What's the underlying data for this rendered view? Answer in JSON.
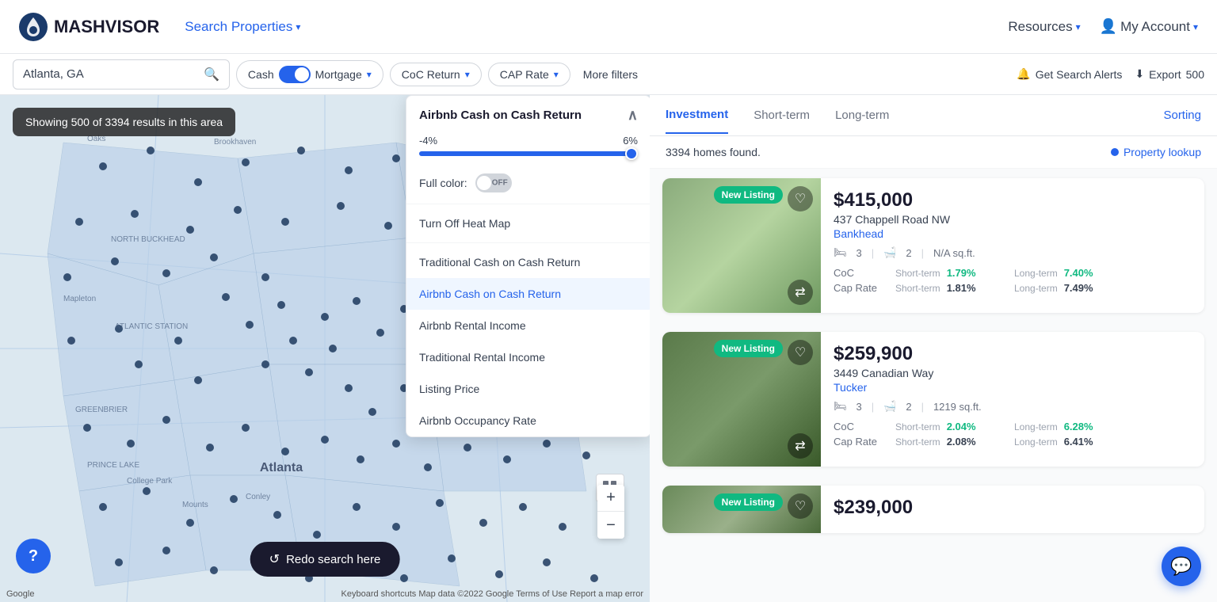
{
  "header": {
    "logo_text": "MASHVISOR",
    "nav_search": "Search Properties",
    "nav_resources": "Resources",
    "nav_account": "My Account"
  },
  "search_bar": {
    "location_value": "Atlanta, GA",
    "location_placeholder": "Atlanta, GA",
    "toggle_label_left": "Cash",
    "toggle_label_right": "Mortgage",
    "filter_coc": "CoC Return",
    "filter_cap": "CAP Rate",
    "more_filters": "More filters",
    "alert_label": "Get Search Alerts",
    "export_label": "Export",
    "export_count": "500"
  },
  "map": {
    "overlay_text": "Showing 500 of 3394 results in this area",
    "redo_label": "Redo search here",
    "attribution": "Google",
    "attribution_right": "Keyboard shortcuts  Map data ©2022 Google  Terms of Use  Report a map error"
  },
  "dropdown": {
    "title": "Airbnb Cash on Cash Return",
    "range_min": "-4%",
    "range_max": "6%",
    "full_color_label": "Full color:",
    "toggle_state": "OFF",
    "items": [
      {
        "label": "Turn Off Heat Map",
        "active": false
      },
      {
        "label": "Traditional Cash on Cash Return",
        "active": false
      },
      {
        "label": "Airbnb Cash on Cash Return",
        "active": true
      },
      {
        "label": "Airbnb Rental Income",
        "active": false
      },
      {
        "label": "Traditional Rental Income",
        "active": false
      },
      {
        "label": "Listing Price",
        "active": false
      },
      {
        "label": "Airbnb Occupancy Rate",
        "active": false
      }
    ]
  },
  "tabs": {
    "items": [
      "Investment",
      "Short-term",
      "Long-term"
    ],
    "active": "Investment",
    "sorting_label": "Sorting"
  },
  "results": {
    "homes_found": "3394 homes found.",
    "property_lookup_label": "Property lookup"
  },
  "properties": [
    {
      "price": "$415,000",
      "address": "437 Chappell Road NW",
      "neighborhood": "Bankhead",
      "beds": "3",
      "baths": "2",
      "sqft": "N/A sq.ft.",
      "new_listing": true,
      "coc_short_term": "1.79%",
      "coc_long_term": "7.40%",
      "cap_short_term": "1.81%",
      "cap_long_term": "7.49%",
      "image_class": "property-image-bg1"
    },
    {
      "price": "$259,900",
      "address": "3449 Canadian Way",
      "neighborhood": "Tucker",
      "beds": "3",
      "baths": "2",
      "sqft": "1219 sq.ft.",
      "new_listing": true,
      "coc_short_term": "2.04%",
      "coc_long_term": "6.28%",
      "cap_short_term": "2.08%",
      "cap_long_term": "6.41%",
      "image_class": "property-image-bg2"
    },
    {
      "price": "$239,000",
      "address": "",
      "neighborhood": "",
      "beds": "",
      "baths": "",
      "sqft": "",
      "new_listing": true,
      "coc_short_term": "",
      "coc_long_term": "",
      "cap_short_term": "",
      "cap_long_term": "",
      "image_class": "property-image-bg3"
    }
  ]
}
